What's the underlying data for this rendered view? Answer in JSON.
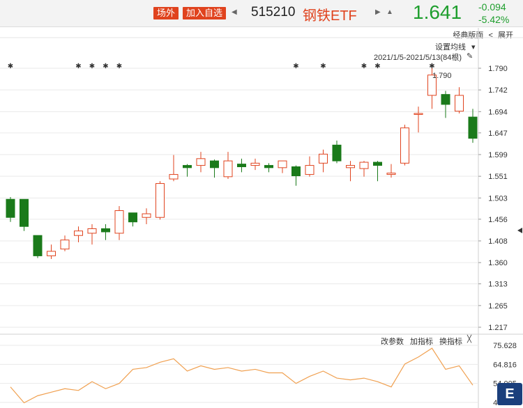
{
  "header": {
    "tag_offexchange": "场外",
    "add_watch": "加入自选",
    "prev_glyph": "◀",
    "code": "515210",
    "name": "钢铁ETF",
    "next_glyph": "▶",
    "bell_glyph": "▲",
    "price": "1.641",
    "change": "-0.094",
    "change_pct": "-5.42%"
  },
  "toolbar": {
    "classic": "经典版面",
    "expand_glyph": "<",
    "expand": "展开"
  },
  "chart_controls": {
    "set_ma": "设置均线",
    "range": "2021/1/5-2021/5/13(84根)",
    "pin_glyph": "📌"
  },
  "indicator_bar": {
    "edit_params": "改参数",
    "add_indicator": "加指标",
    "switch_indicator": "换指标",
    "close_glyph": "╳"
  },
  "logo_text": "E",
  "colors": {
    "up": "#e0431e",
    "down": "#1a7a1a",
    "line": "#f0a050",
    "grid": "#eaeaea"
  },
  "chart_data": {
    "type": "candlestick",
    "y_ticks": [
      "1.790",
      "1.742",
      "1.694",
      "1.647",
      "1.599",
      "1.551",
      "1.503",
      "1.456",
      "1.408",
      "1.360",
      "1.313",
      "1.265",
      "1.217"
    ],
    "ylim": [
      1.217,
      1.79
    ],
    "max_label": "1.790",
    "candles": [
      {
        "o": 1.5,
        "h": 1.505,
        "l": 1.45,
        "c": 1.46
      },
      {
        "o": 1.5,
        "h": 1.5,
        "l": 1.43,
        "c": 1.44
      },
      {
        "o": 1.42,
        "h": 1.42,
        "l": 1.37,
        "c": 1.375
      },
      {
        "o": 1.375,
        "h": 1.4,
        "l": 1.368,
        "c": 1.385
      },
      {
        "o": 1.39,
        "h": 1.42,
        "l": 1.385,
        "c": 1.41
      },
      {
        "o": 1.42,
        "h": 1.44,
        "l": 1.405,
        "c": 1.43
      },
      {
        "o": 1.425,
        "h": 1.445,
        "l": 1.4,
        "c": 1.435
      },
      {
        "o": 1.435,
        "h": 1.445,
        "l": 1.41,
        "c": 1.428
      },
      {
        "o": 1.425,
        "h": 1.485,
        "l": 1.41,
        "c": 1.475
      },
      {
        "o": 1.47,
        "h": 1.47,
        "l": 1.44,
        "c": 1.45
      },
      {
        "o": 1.46,
        "h": 1.48,
        "l": 1.445,
        "c": 1.468
      },
      {
        "o": 1.46,
        "h": 1.54,
        "l": 1.455,
        "c": 1.535
      },
      {
        "o": 1.545,
        "h": 1.598,
        "l": 1.54,
        "c": 1.555
      },
      {
        "o": 1.575,
        "h": 1.578,
        "l": 1.55,
        "c": 1.57
      },
      {
        "o": 1.575,
        "h": 1.605,
        "l": 1.56,
        "c": 1.59
      },
      {
        "o": 1.585,
        "h": 1.588,
        "l": 1.548,
        "c": 1.57
      },
      {
        "o": 1.55,
        "h": 1.605,
        "l": 1.545,
        "c": 1.585
      },
      {
        "o": 1.578,
        "h": 1.59,
        "l": 1.56,
        "c": 1.572
      },
      {
        "o": 1.575,
        "h": 1.59,
        "l": 1.565,
        "c": 1.58
      },
      {
        "o": 1.575,
        "h": 1.58,
        "l": 1.56,
        "c": 1.57
      },
      {
        "o": 1.57,
        "h": 1.585,
        "l": 1.558,
        "c": 1.585
      },
      {
        "o": 1.572,
        "h": 1.575,
        "l": 1.53,
        "c": 1.552
      },
      {
        "o": 1.555,
        "h": 1.595,
        "l": 1.55,
        "c": 1.575
      },
      {
        "o": 1.58,
        "h": 1.61,
        "l": 1.56,
        "c": 1.6
      },
      {
        "o": 1.62,
        "h": 1.63,
        "l": 1.58,
        "c": 1.585
      },
      {
        "o": 1.57,
        "h": 1.585,
        "l": 1.54,
        "c": 1.575
      },
      {
        "o": 1.568,
        "h": 1.585,
        "l": 1.55,
        "c": 1.582
      },
      {
        "o": 1.582,
        "h": 1.585,
        "l": 1.54,
        "c": 1.575
      },
      {
        "o": 1.555,
        "h": 1.578,
        "l": 1.548,
        "c": 1.558
      },
      {
        "o": 1.58,
        "h": 1.665,
        "l": 1.575,
        "c": 1.658
      },
      {
        "o": 1.69,
        "h": 1.705,
        "l": 1.648,
        "c": 1.69
      },
      {
        "o": 1.73,
        "h": 1.79,
        "l": 1.7,
        "c": 1.775
      },
      {
        "o": 1.732,
        "h": 1.74,
        "l": 1.68,
        "c": 1.71
      },
      {
        "o": 1.695,
        "h": 1.748,
        "l": 1.69,
        "c": 1.73
      },
      {
        "o": 1.682,
        "h": 1.7,
        "l": 1.625,
        "c": 1.635
      }
    ],
    "star_marks": [
      0,
      5,
      6,
      7,
      8,
      21,
      23,
      26,
      27,
      31
    ],
    "indicator": {
      "y_ticks": [
        "75.628",
        "64.816",
        "54.005",
        "43.193"
      ],
      "ylim": [
        43.193,
        75.628
      ],
      "values": [
        52,
        43,
        47,
        49,
        51,
        50,
        55,
        51,
        54,
        62,
        63,
        66,
        68,
        61,
        64,
        62,
        63,
        61,
        62,
        60,
        60,
        54,
        58,
        61,
        57,
        56,
        57,
        55,
        52,
        65,
        69,
        74,
        62,
        64,
        53
      ]
    }
  }
}
